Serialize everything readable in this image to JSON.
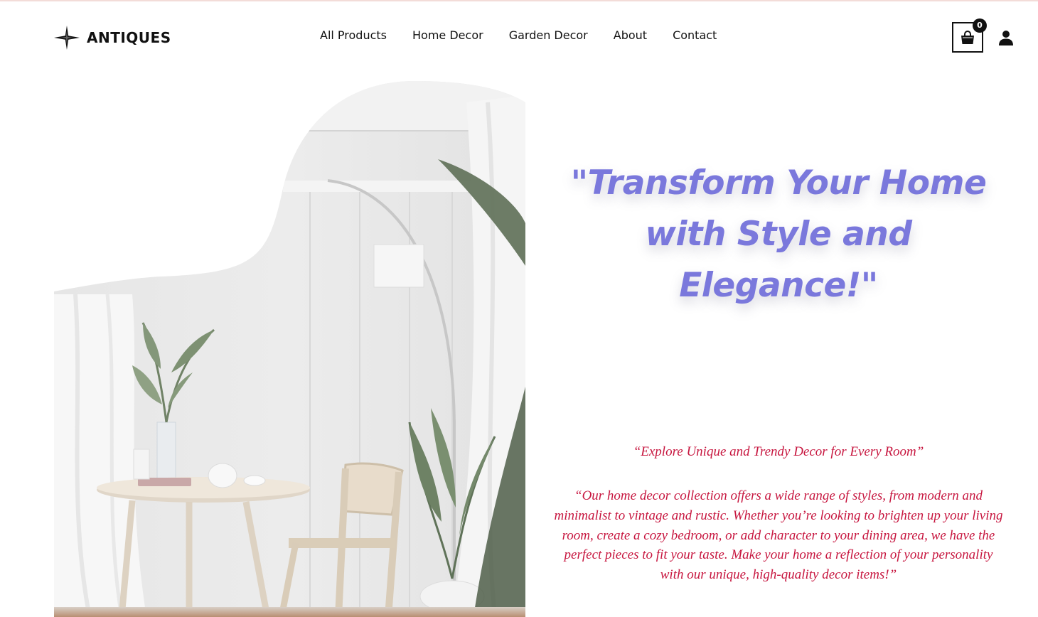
{
  "brand": {
    "name": "ANTIQUES",
    "icon": "four-point-star-icon"
  },
  "nav": {
    "items": [
      {
        "label": "All Products"
      },
      {
        "label": "Home Decor"
      },
      {
        "label": "Garden Decor"
      },
      {
        "label": "About"
      },
      {
        "label": "Contact"
      }
    ]
  },
  "header_actions": {
    "cart_icon": "shopping-bag-icon",
    "cart_count": "0",
    "user_icon": "user-icon"
  },
  "hero": {
    "image_subject": "white room interior with round wooden table, chair, arc floor lamp and potted plants",
    "headline": "\"Transform Your Home with Style and Elegance!\"",
    "sub_tagline": "“Explore Unique and Trendy Decor for Every Room”",
    "description": "“Our home decor collection offers a wide range of styles, from modern and minimalist to vintage and rustic. Whether you’re looking to brighten up your living room, create a cozy bedroom, or add character to your dining area, we have the perfect pieces to fit your taste. Make your home a reflection of your personality with our unique, high-quality decor items!”"
  },
  "colors": {
    "headline": "#7a78dc",
    "body_text": "#c7163f",
    "top_strip": "#f3dcd8",
    "ink": "#111111"
  }
}
